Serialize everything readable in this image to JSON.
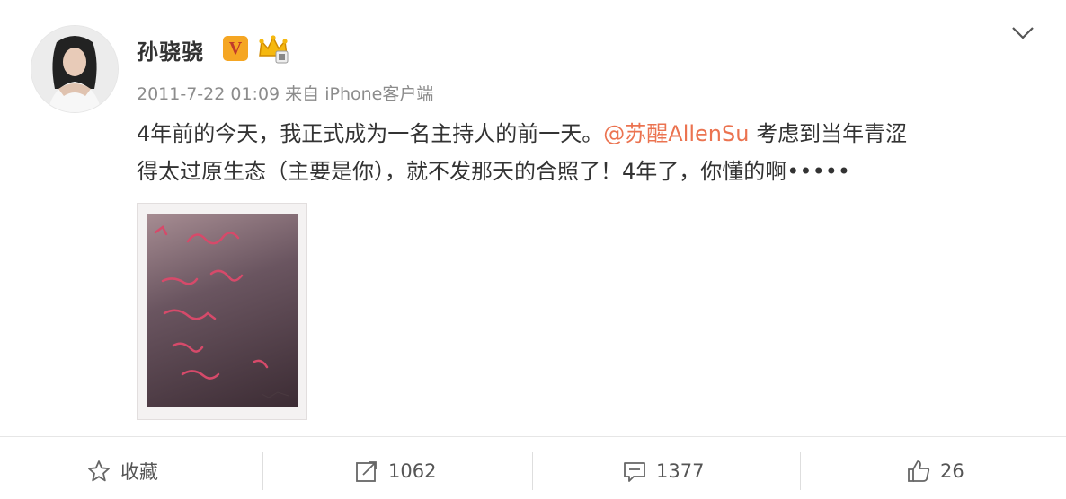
{
  "post": {
    "username": "孙骁骁",
    "verified_badge": "V",
    "time": "2011-7-22 01:09",
    "source": "来自 iPhone客户端",
    "text_part1": "4年前的今天，我正式成为一名主持人的前一天。",
    "mention": "@苏醒AllenSu",
    "text_part2": " 考虑到当年青涩",
    "text_line2": "得太过原生态（主要是你），就不发那天的合照了！4年了，你懂的啊•••••"
  },
  "actions": {
    "favorite": "收藏",
    "repost_count": "1062",
    "comment_count": "1377",
    "like_count": "26"
  },
  "colors": {
    "mention": "#eb7350",
    "badge": "#f5a623",
    "meta": "#8c8c8c"
  },
  "icons": [
    "avatar",
    "verified-badge-icon",
    "crown-icon",
    "chevron-down-icon",
    "star-icon",
    "repost-icon",
    "comment-icon",
    "like-icon"
  ]
}
